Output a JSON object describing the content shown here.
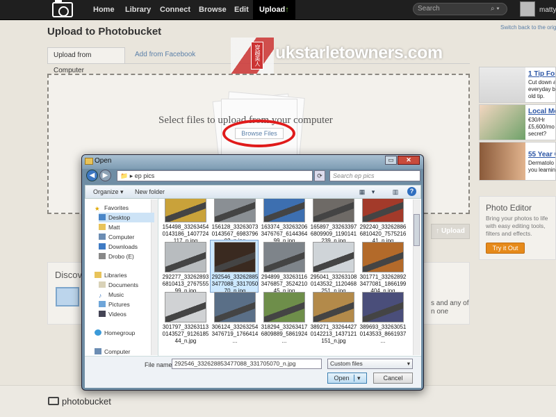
{
  "topnav": {
    "items": [
      "Home",
      "Library",
      "Connect",
      "Browse",
      "Edit",
      "Upload"
    ],
    "upload_arrow": "↑",
    "search_placeholder": "Search",
    "username": "matty"
  },
  "page": {
    "switch_link": "Switch back to the origi",
    "title": "Upload to Photobucket",
    "tabs": [
      "Upload from Computer",
      "Add from Facebook"
    ],
    "watermark": {
      "cjk": "穿越英人",
      "text": "ukstarletowners.com"
    },
    "select_text": "Select files to upload from your computer",
    "browse_button": "Browse Files",
    "upload_button": "Upload",
    "upload_button_icon": "upload-arrow-icon",
    "discover_title": "Discov",
    "discover_line1": "s and any of",
    "discover_line2": "n one"
  },
  "ads": [
    {
      "title": "1 Tip For",
      "lines": [
        "Cut down a",
        "everyday b",
        "old tip."
      ]
    },
    {
      "title": "Local Mo",
      "lines": [
        "€30/Hr",
        "£5,600/mo",
        "secret?"
      ]
    },
    {
      "title": "55 Year O",
      "lines": [
        "Dermatolo",
        "you learnin"
      ]
    }
  ],
  "photo_editor": {
    "title": "Photo Editor",
    "text": "Bring your photos to life with easy editing tools, filters and effects.",
    "button": "Try it Out"
  },
  "footer": {
    "logo_text": "photobucket"
  },
  "dialog": {
    "title": "Open",
    "path_folder": "ep pics",
    "search_placeholder": "Search ep pics",
    "toolbar": {
      "organize": "Organize ▾",
      "new_folder": "New folder"
    },
    "nav_items": [
      {
        "label": "Favorites",
        "icon": "star-icon"
      },
      {
        "label": "Desktop",
        "icon": "desktop-icon"
      },
      {
        "label": "Matt",
        "icon": "user-folder-icon"
      },
      {
        "label": "Computer",
        "icon": "computer-icon"
      },
      {
        "label": "Downloads",
        "icon": "downloads-icon"
      },
      {
        "label": "Drobo (E)",
        "icon": "drive-icon"
      },
      {
        "label": "Libraries",
        "icon": "libraries-icon"
      },
      {
        "label": "Documents",
        "icon": "documents-icon"
      },
      {
        "label": "Music",
        "icon": "music-icon"
      },
      {
        "label": "Pictures",
        "icon": "pictures-icon"
      },
      {
        "label": "Videos",
        "icon": "videos-icon"
      },
      {
        "label": "Homegroup",
        "icon": "homegroup-icon"
      },
      {
        "label": "Computer",
        "icon": "computer-icon"
      }
    ],
    "files": [
      {
        "name": "154498_33263454 0143186_1407724 117_n.jpg",
        "color": "#c9a23a"
      },
      {
        "name": "156128_33263073 0143567_6983796 03_n.jpg",
        "color": "#8a8f94"
      },
      {
        "name": "163374_33263206 3476767_6144364 99_n.jpg",
        "color": "#3d6fb0"
      },
      {
        "name": "165897_33263397 6809909_1190141 239_n.jpg",
        "color": "#6e6a66"
      },
      {
        "name": "292240_33262886 6810420_7575216 41_n.jpg",
        "color": "#a33a2a"
      },
      {
        "name": "292277_33262893 6810413_2767555 99_n.jpg",
        "color": "#b8bcbf"
      },
      {
        "name": "292546_33262885 3477088_3317050 70_n.jpg",
        "color": "#3a2a20"
      },
      {
        "name": "294899_33263116 3476857_3524210 45_n.jpg",
        "color": "#7e848a"
      },
      {
        "name": "295041_33263108 0143532_1120468 251_n.jpg",
        "color": "#cfd4d8"
      },
      {
        "name": "301771_33262892 3477081_1866199 404_n.jpg",
        "color": "#b36a2a"
      },
      {
        "name": "301797_33263113 0143527_9126185 44_n.jpg",
        "color": "#d0d2d4"
      },
      {
        "name": "306124_33263254 3476719_1766414 ...",
        "color": "#5a6f87"
      },
      {
        "name": "318294_33263417 6809889_5861924 ...",
        "color": "#6e8e4a"
      },
      {
        "name": "389271_33264427 0142213_1437121 151_n.jpg",
        "color": "#b38a4a"
      },
      {
        "name": "389693_33263051 0143533_8661937 ...",
        "color": "#4a4e7a"
      }
    ],
    "selected_index": 6,
    "file_name_label": "File name:",
    "file_name_value": "292546_332628853477088_331705070_n.jpg",
    "file_type": "Custom files",
    "open_button": "Open",
    "cancel_button": "Cancel"
  },
  "colors": {
    "accent_link": "#5a7fa8",
    "highlight": "#e01b1b",
    "cta_orange": "#e68a1a"
  }
}
